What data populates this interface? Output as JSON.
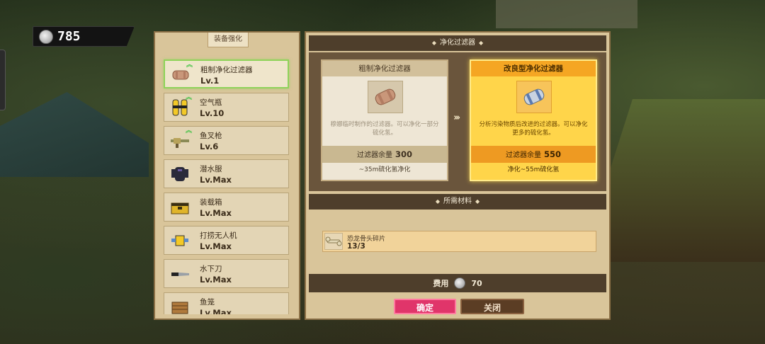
{
  "currency": {
    "icon": "silver-coin-icon",
    "value": "785"
  },
  "left_panel": {
    "title": "装备强化",
    "items": [
      {
        "name": "粗制净化过滤器",
        "level": "Lv.1",
        "icon": "filter-icon",
        "upgradable": true,
        "selected": true
      },
      {
        "name": "空气瓶",
        "level": "Lv.10",
        "icon": "air-tank-icon",
        "upgradable": true,
        "selected": false
      },
      {
        "name": "鱼叉枪",
        "level": "Lv.6",
        "icon": "harpoon-gun-icon",
        "upgradable": true,
        "selected": false
      },
      {
        "name": "潜水服",
        "level": "Lv.Max",
        "icon": "diving-suit-icon",
        "upgradable": false,
        "selected": false
      },
      {
        "name": "装载箱",
        "level": "Lv.Max",
        "icon": "cargo-box-icon",
        "upgradable": false,
        "selected": false
      },
      {
        "name": "打捞无人机",
        "level": "Lv.Max",
        "icon": "salvage-drone-icon",
        "upgradable": false,
        "selected": false
      },
      {
        "name": "水下刀",
        "level": "Lv.Max",
        "icon": "dive-knife-icon",
        "upgradable": false,
        "selected": false
      },
      {
        "name": "鱼笼",
        "level": "Lv.Max",
        "icon": "fish-trap-icon",
        "upgradable": false,
        "selected": false
      }
    ]
  },
  "right_panel": {
    "section_title": "净化过滤器",
    "current": {
      "name": "粗制净化过滤器",
      "description": "穆娜临时制作的过滤器。可以净化一部分硫化氢。",
      "capacity_label": "过滤器余量",
      "capacity_value": "300",
      "effect": "~35m硫化氢净化"
    },
    "next": {
      "name": "改良型净化过滤器",
      "description": "分析污染物质后改进的过滤器。可以净化更多的硫化氢。",
      "capacity_label": "过滤器余量",
      "capacity_value": "550",
      "effect": "净化~55m硫化氢"
    },
    "materials_title": "所需材料",
    "materials": [
      {
        "name": "恐龙骨头碎片",
        "count": "13/3",
        "icon": "bone-fragment-icon"
      }
    ],
    "cost_label": "费用",
    "cost_value": "70",
    "confirm_label": "确定",
    "close_label": "关闭"
  },
  "colors": {
    "accent_confirm": "#e0356a",
    "selected_border": "#8fd35a",
    "next_card": "#ffd54a",
    "panel_bg": "#d9c59a",
    "bar_dark": "#4e3e2b"
  }
}
